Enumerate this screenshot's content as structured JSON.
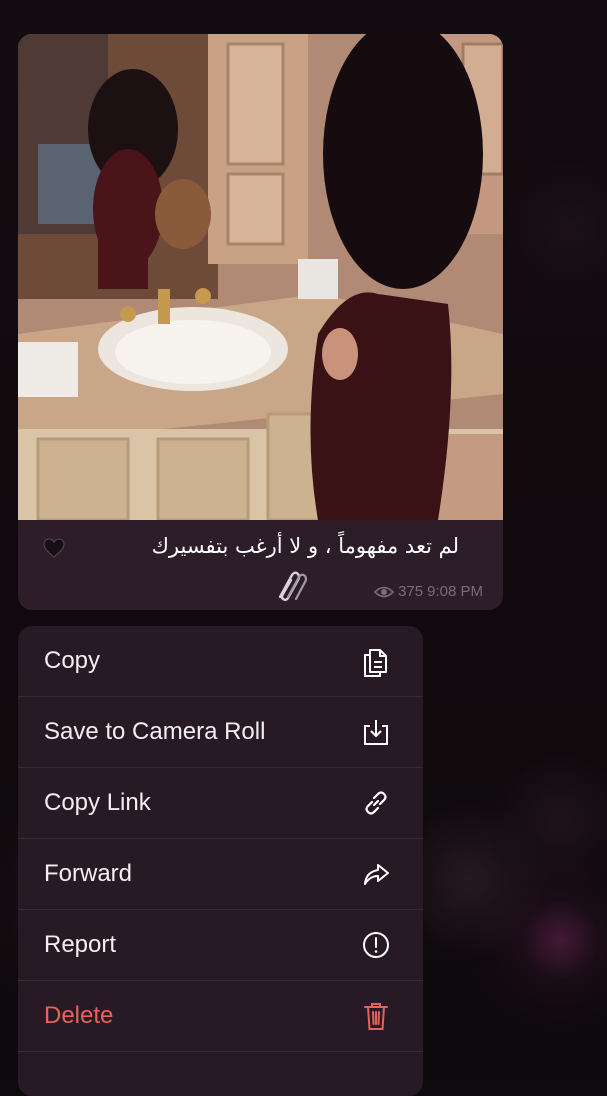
{
  "message": {
    "caption": "لم تعد مفهوماً ، و لا أرغب بتفسيرك",
    "heart_icon": "black-heart-emoji",
    "clip_icon": "paperclip-icon",
    "views": "375",
    "time": "9:08 PM",
    "views_icon": "eye-icon"
  },
  "menu": {
    "items": [
      {
        "label": "Copy",
        "icon": "copy-icon"
      },
      {
        "label": "Save to Camera Roll",
        "icon": "download-icon"
      },
      {
        "label": "Copy Link",
        "icon": "link-icon"
      },
      {
        "label": "Forward",
        "icon": "forward-icon"
      },
      {
        "label": "Report",
        "icon": "report-icon"
      },
      {
        "label": "Delete",
        "icon": "trash-icon"
      }
    ]
  },
  "colors": {
    "bubble": "#2c1d29",
    "menu": "#281a24",
    "danger": "#e8625c",
    "meta": "#7e6a78"
  }
}
